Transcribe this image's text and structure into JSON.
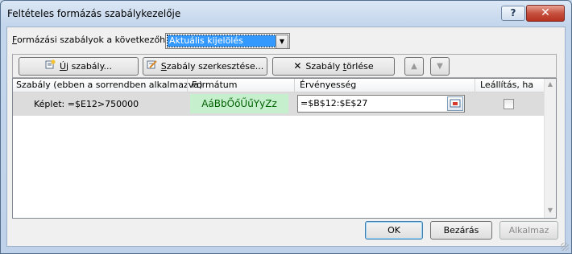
{
  "window": {
    "title": "Feltételes formázás szabálykezelője",
    "help_glyph": "?",
    "close_glyph": "✕"
  },
  "show_rules": {
    "label_prefix": "F",
    "label_rest": "ormázási szabályok a következőhöz:",
    "selected": "Aktuális kijelölés",
    "options": [
      "Aktuális kijelölés"
    ]
  },
  "toolbar": {
    "new_rule_icon": "new-rule-icon",
    "new_rule_underlined": "Ú",
    "new_rule_rest": "j szabály...",
    "edit_rule_icon": "edit-rule-icon",
    "edit_rule_underlined": "S",
    "edit_rule_rest": "zabály szerkesztése...",
    "delete_rule_icon": "delete-x-icon",
    "delete_rule_pre": "Szabály ",
    "delete_rule_underlined": "t",
    "delete_rule_rest": "örlése",
    "move_up_glyph": "▲",
    "move_down_glyph": "▼"
  },
  "grid": {
    "columns": [
      "Szabály (ebben a sorrendben alkalmazva)",
      "Formátum",
      "Érvényesség",
      "Leállítás, ha igaz"
    ],
    "rows": [
      {
        "rule": "Képlet: =$E12>750000",
        "format_preview": "AáBbŐőŰűYyZz",
        "applies_to": "=$B$12:$E$27",
        "stop_if_true": false
      }
    ],
    "format_preview_colors": {
      "fill": "#c6efce",
      "text": "#006100"
    }
  },
  "footer": {
    "ok": "OK",
    "close": "Bezárás",
    "apply": "Alkalmaz"
  }
}
